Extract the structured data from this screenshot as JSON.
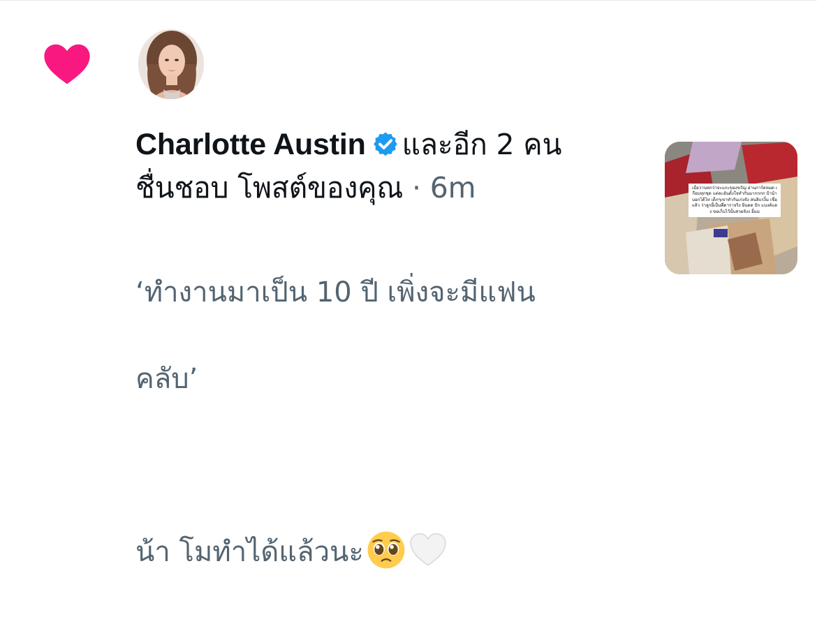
{
  "notification": {
    "type_icon": "heart-icon",
    "type_icon_color": "#F91880",
    "actor_name": "Charlotte Austin",
    "actor_verified_icon": "verified-badge-icon",
    "verified_color": "#1D9BF0",
    "and_others": "และอีก 2 คน",
    "action_text": "ชื่นชอบ โพสต์ของคุณ",
    "separator": "·",
    "time": "6m"
  },
  "post": {
    "line1": "‘ทำงานมาเป็น 10 ปี เพิ่งจะมีแฟน",
    "line2": "คลับ’",
    "line3": "น้า โมทำได้แล้วนะ",
    "emoji_1": "pleading-face-emoji",
    "emoji_2": "white-heart-emoji"
  },
  "thumbnail": {
    "caption": "เมื่อวานหกว่าจะแกะของขวัญ อ่านการ์ดหมด เกือบทุกชุด แต่ละอันตั้งใจทำกันมากกกก ป้าน้า บอกได้ไห เด็กๆเขาทำกันเก่งจัง สนสิแรงิ้ม เชื่อแล้ว ว่าลูกยิ้เป็นพี่ดาราจริง ยิ่นดต ปัก แบงค์แดง ขอเก็บไว้นั้บสวยจังง อิ้มม"
  }
}
